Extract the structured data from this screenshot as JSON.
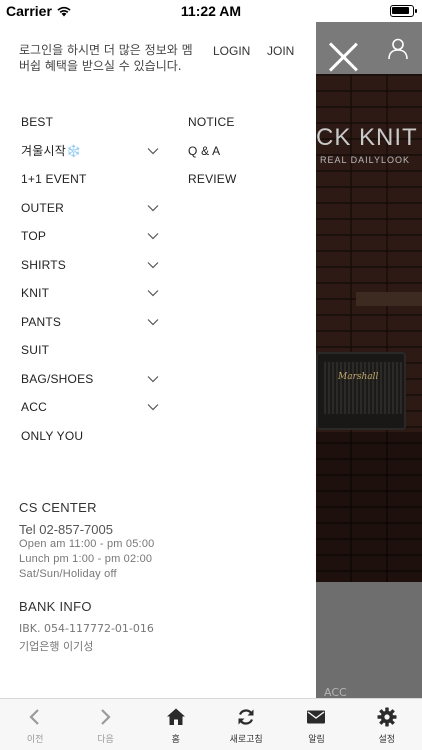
{
  "status_bar": {
    "carrier": "Carrier",
    "time": "11:22 AM",
    "battery_level": 0.9
  },
  "drawer": {
    "login_message": "로그인을 하시면 더 많은 정보와 멤버쉽 혜택을 받으실 수 있습니다.",
    "login_label": "LOGIN",
    "join_label": "JOIN",
    "menu_left": [
      {
        "label": "BEST",
        "has_submenu": false
      },
      {
        "label": "겨울시작❄️",
        "has_submenu": true
      },
      {
        "label": "1+1 EVENT",
        "has_submenu": false
      },
      {
        "label": "OUTER",
        "has_submenu": true
      },
      {
        "label": "TOP",
        "has_submenu": true
      },
      {
        "label": "SHIRTS",
        "has_submenu": true
      },
      {
        "label": "KNIT",
        "has_submenu": true
      },
      {
        "label": "PANTS",
        "has_submenu": true
      },
      {
        "label": "SUIT",
        "has_submenu": false
      },
      {
        "label": "BAG/SHOES",
        "has_submenu": true
      },
      {
        "label": "ACC",
        "has_submenu": true
      },
      {
        "label": "ONLY YOU",
        "has_submenu": false
      }
    ],
    "menu_right": [
      {
        "label": "NOTICE"
      },
      {
        "label": "Q & A"
      },
      {
        "label": "REVIEW"
      }
    ],
    "cs": {
      "title": "CS CENTER",
      "tel": "Tel 02-857-7005",
      "open": "Open am 11:00 - pm 05:00",
      "lunch": "Lunch pm 1:00 - pm 02:00",
      "off": "Sat/Sun/Holiday off"
    },
    "bank": {
      "title": "BANK INFO",
      "account": "IBK. 054-117772-01-016",
      "holder": "기업은행 이기성"
    }
  },
  "background": {
    "banner_text": "CK KNIT",
    "banner_sub": "REAL DAILYLOOK",
    "speaker_brand": "Marshall",
    "acc_label": "ACC"
  },
  "toolbar": {
    "items": [
      {
        "label": "이전",
        "icon": "chevron-left-icon",
        "enabled": false
      },
      {
        "label": "다음",
        "icon": "chevron-right-icon",
        "enabled": false
      },
      {
        "label": "홈",
        "icon": "home-icon",
        "enabled": true
      },
      {
        "label": "새로고침",
        "icon": "refresh-icon",
        "enabled": true
      },
      {
        "label": "알림",
        "icon": "mail-icon",
        "enabled": true
      },
      {
        "label": "설정",
        "icon": "gear-icon",
        "enabled": true
      }
    ]
  },
  "colors": {
    "accent": "#222222",
    "overlay_gray": "#7a7a7a",
    "muted_text": "#777777"
  }
}
